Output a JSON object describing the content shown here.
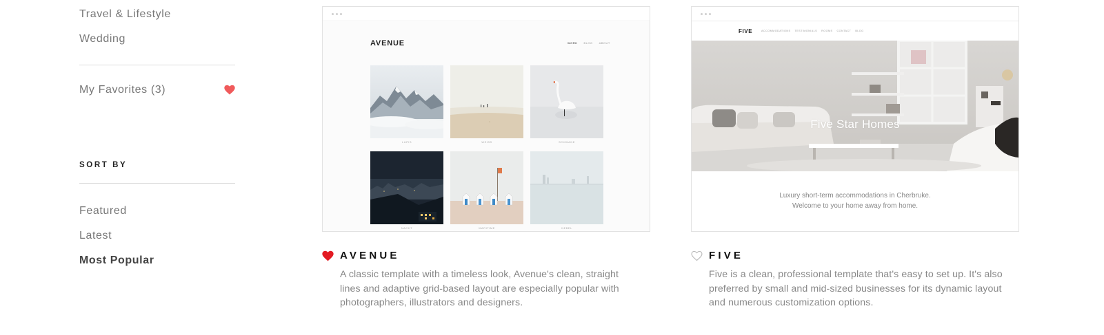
{
  "sidebar": {
    "categories": [
      {
        "label": "Travel & Lifestyle"
      },
      {
        "label": "Wedding"
      }
    ],
    "favorites": {
      "label": "My Favorites (3)",
      "heart_color": "#f05a5b"
    },
    "sort": {
      "heading": "SORT BY",
      "options": [
        {
          "label": "Featured",
          "active": false
        },
        {
          "label": "Latest",
          "active": false
        },
        {
          "label": "Most Popular",
          "active": true
        }
      ]
    }
  },
  "templates": [
    {
      "title": "AVENUE",
      "favorited": true,
      "heart_color": "#e31b23",
      "description": "A classic template with a timeless look, Avenue's clean, straight lines and adaptive grid-based layout are especially popular with photographers, illustrators and designers.",
      "preview": {
        "logo": "AVENUE",
        "nav": [
          "WORK",
          "BLOG",
          "ABOUT"
        ],
        "captions": [
          "LUPIS",
          "WEISS",
          "SCHWANE",
          "NACHT",
          "MARITIME",
          "NEBEL"
        ]
      }
    },
    {
      "title": "FIVE",
      "favorited": false,
      "heart_color": "#bbbbbb",
      "description": "Five is a clean, professional template that's easy to set up. It's also preferred by small and mid-sized businesses for its dynamic layout and numerous customization options.",
      "preview": {
        "logo": "FIVE",
        "nav": [
          "ACCOMMODATIONS",
          "TESTIMONIALS",
          "ROOMS",
          "CONTACT",
          "BLOG"
        ],
        "hero_title": "Five Star Homes",
        "tagline_line1": "Luxury short-term accommodations in Cherbruke.",
        "tagline_line2": "Welcome to your home away from home."
      }
    }
  ]
}
